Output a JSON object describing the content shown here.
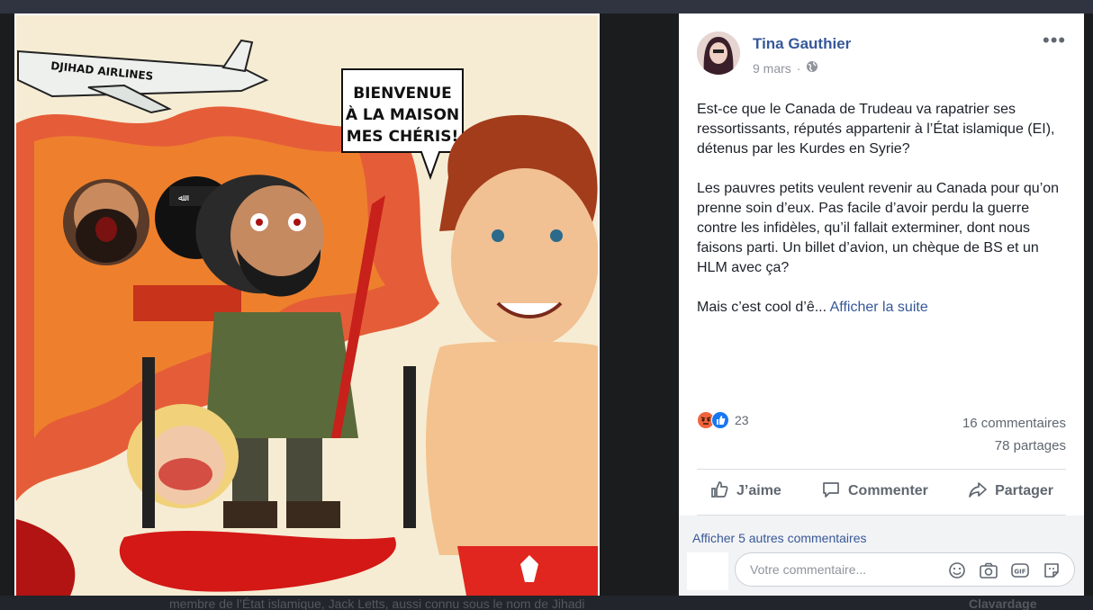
{
  "image": {
    "speech_bubble": [
      "BIENVENUE",
      "À LA MAISON",
      "MES CHÉRIS!"
    ],
    "plane_label": "DJIHAD AIRLINES"
  },
  "post": {
    "author": "Tina Gauthier",
    "date": "9 mars",
    "paragraphs": [
      "Est-ce que le Canada de Trudeau va rapatrier ses ressortissants, réputés appartenir à l’État islamique (EI), détenus par les Kurdes en Syrie?",
      "Les pauvres petits veulent revenir au Canada pour qu’on prenne soin d’eux. Pas facile d’avoir perdu la guerre contre les infidèles, qu’il fallait exterminer, dont nous faisons parti. Un billet d’avion, un chèque de BS et un HLM avec ça?"
    ],
    "truncated_text": "Mais c’est cool d’ê...",
    "see_more": "Afficher la suite"
  },
  "stats": {
    "reaction_count": "23",
    "comments": "16 commentaires",
    "shares": "78 partages"
  },
  "actions": {
    "like": "J’aime",
    "comment": "Commenter",
    "share": "Partager"
  },
  "comments": {
    "show_more": "Afficher 5 autres commentaires",
    "placeholder": "Votre commentaire..."
  },
  "background": {
    "underlying_text": "membre de l’État islamique, Jack Letts, aussi connu sous le nom de Jihadi",
    "chat": "Clavardage"
  },
  "colors": {
    "link": "#365899",
    "like_blue": "#1877f2",
    "angry": "#f0643c"
  }
}
